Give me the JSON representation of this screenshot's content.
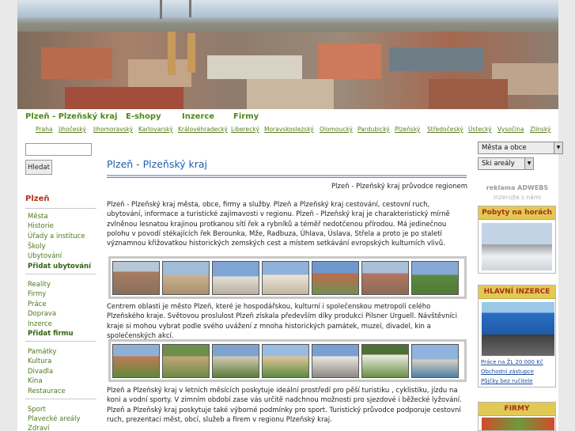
{
  "topnav": {
    "items": [
      "Plzeň - Plzeňský kraj",
      "E-shopy",
      "Inzerce",
      "Firmy"
    ]
  },
  "regions": [
    "Praha",
    "Jihočeský",
    "Jihomoravský",
    "Karlovarský",
    "Královéhradecký",
    "Liberecký",
    "Moravskoslezský",
    "Olomoucký",
    "Pardubický",
    "Plzeňský",
    "Středočeský",
    "Ústecký",
    "Vysočina",
    "Zlínský"
  ],
  "search": {
    "placeholder": "",
    "button_label": "Hledat"
  },
  "sidebar": {
    "heading": "Plzeň",
    "group1": [
      "Města",
      "Historie",
      "Úřady a instituce",
      "Školy",
      "Ubytování",
      "Přidat ubytování"
    ],
    "group2": [
      "Reality",
      "Firmy",
      "Práce",
      "Doprava",
      "Inzerce",
      "Přidat firmu"
    ],
    "group3": [
      "Památky",
      "Kultura",
      "Divadla",
      "Kina",
      "Restaurace"
    ],
    "group4": [
      "Sport",
      "Plavecké areály",
      "Zdraví"
    ]
  },
  "main": {
    "title": "Plzeň - Plzeňský kraj",
    "tagline": "Plzeň - Plzeňský kraj průvodce regionem",
    "para1": "Plzeň - Plzeňský kraj města, obce, firmy a služby. Plzeň a Plzeňský kraj cestování, cestovní ruch, ubytování, informace a turistické zajímavosti v regionu. Plzeň - Plzeňský kraj je charakteristický mírně zvlněnou lesnatou krajinou protkanou sítí řek a rybníků a téměř nedotčenou přírodou. Má jedinečnou polohu v povodí stékajících řek Berounka, Mže, Radbuza, Úhlava, Úslava, Střela a proto je po staletí významnou křižovatkou historických zemských cest a místem setkávání evropských kulturních vlivů.",
    "para2": "Centrem oblasti je město Plzeň, které je hospodářskou, kulturní i společenskou metropolí celého Plzeňského kraje. Světovou proslulost Plzeň získala především díky produkci Pilsner Urguell. Návštěvníci kraje si mohou vybrat podle svého uvážení z mnoha historických památek, muzeí, divadel, kin a společenských akcí.",
    "para3": "Plzeň a Plzeňský kraj v letních měsících poskytuje ideální prostředí pro pěší turistiku , cyklistiku, jízdu na koni a vodní sporty. V zimním období zase vás určitě nadchnou možnosti pro sjezdové i běžecké lyžování. Plzeň a Plzeňský kraj poskytuje také výborné podmínky pro sport. Turistický průvodce podporuje cestovní ruch, prezentaci měst, obcí, služeb a firem v regionu Plzeňský kraj."
  },
  "right": {
    "select1": "Města a obce",
    "select2": "Ski areály",
    "ad_label": "reklama ADWEBS",
    "ad_sub": "inzerujte s námi",
    "box1_title": "Pobyty na horách",
    "box2_title": "HLAVNÍ INZERCE",
    "box2_links": [
      "Práce na ŽL 20 000 Kč",
      "Obchodní zástupce",
      "Půjčky bez ručitele"
    ],
    "box3_title": "FIRMY"
  },
  "colors": {
    "nav_green": "#4c8a16",
    "title_blue": "#1d5eab",
    "heading_red": "#b2331c",
    "box_gold": "#e2c954"
  }
}
